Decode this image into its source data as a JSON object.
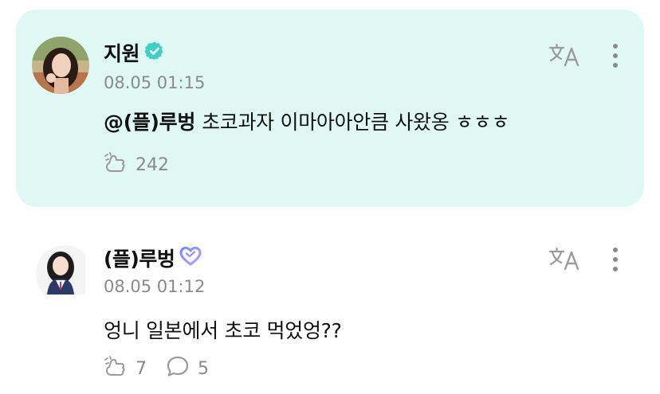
{
  "post": {
    "author": "지원",
    "verified_icon": "verified-badge-icon",
    "timestamp": "08.05 01:15",
    "mention": "@(플)루벙",
    "text": "초코과자 이마아아안큼 사왔옹 ㅎㅎㅎ",
    "like_count": "242",
    "translate_icon": "translate-icon",
    "more_icon": "more-vertical-icon",
    "background_color": "#dff8f4"
  },
  "comment": {
    "author": "(플)루벙",
    "badge_icon": "heart-badge-icon",
    "timestamp": "08.05 01:12",
    "text": "엉니 일본에서 초코 먹었엉??",
    "like_count": "7",
    "reply_count": "5",
    "translate_icon": "translate-icon",
    "more_icon": "more-vertical-icon"
  },
  "colors": {
    "verified": "#3fd0c4",
    "heart_badge_start": "#6f8cff",
    "heart_badge_end": "#b89bff",
    "muted": "#8a8a8a"
  }
}
